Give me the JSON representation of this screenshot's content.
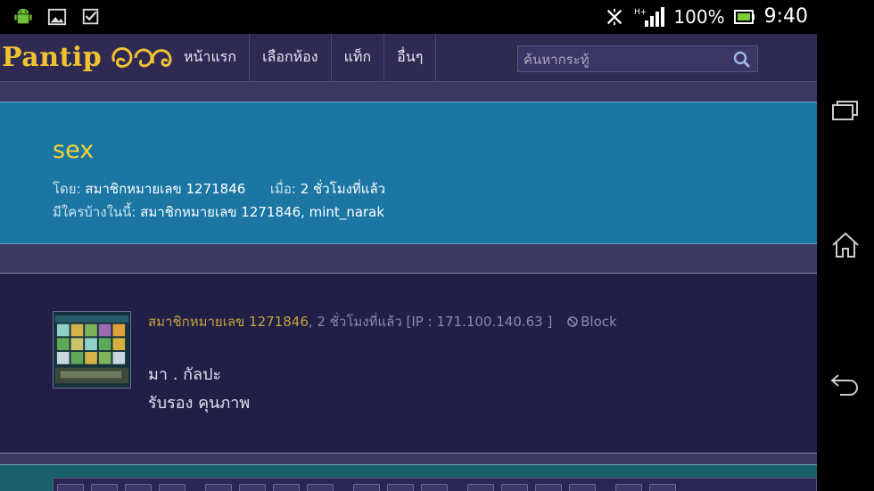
{
  "status_bar": {
    "battery_percent": "100%",
    "time": "9:40",
    "signal_label": "H+"
  },
  "site": {
    "logo_text": "Pantip",
    "logo_thai": "๑๒",
    "menu": [
      {
        "label": "หน้าแรก"
      },
      {
        "label": "เลือกห้อง"
      },
      {
        "label": "แท็ก"
      },
      {
        "label": "อื่นๆ"
      }
    ],
    "search_placeholder": "ค้นหากระทู้"
  },
  "topic": {
    "title": "sex",
    "by_label": "โดย:",
    "by_value": "สมาชิกหมายเลข 1271846",
    "when_label": "เมื่อ:",
    "when_value": "2 ชั่วโมงที่แล้ว",
    "who_label": "มีใครบ้างในนี้:",
    "who_value": "สมาชิกหมายเลข 1271846, mint_narak"
  },
  "comment": {
    "author": "สมาชิกหมายเลข 1271846",
    "time_ip": ", 2 ชั่วโมงที่แล้ว [IP : 171.100.140.63 ]",
    "block_label": "Block",
    "line1": "มา . กัลปะ",
    "line2": "รับรอง คุนภาพ"
  },
  "icons": {
    "android": "android-icon",
    "gallery": "gallery-icon",
    "checkbox": "checkbox-icon",
    "nfc": "nfc-icon",
    "search": "search-icon",
    "block": "block-icon",
    "recents": "recents-icon",
    "home": "home-icon",
    "back": "back-icon"
  },
  "colors": {
    "accent_yellow": "#f4d33a",
    "topic_bg": "#1b76a4",
    "page_bg": "#3b3761",
    "comment_bg": "#221f47"
  }
}
